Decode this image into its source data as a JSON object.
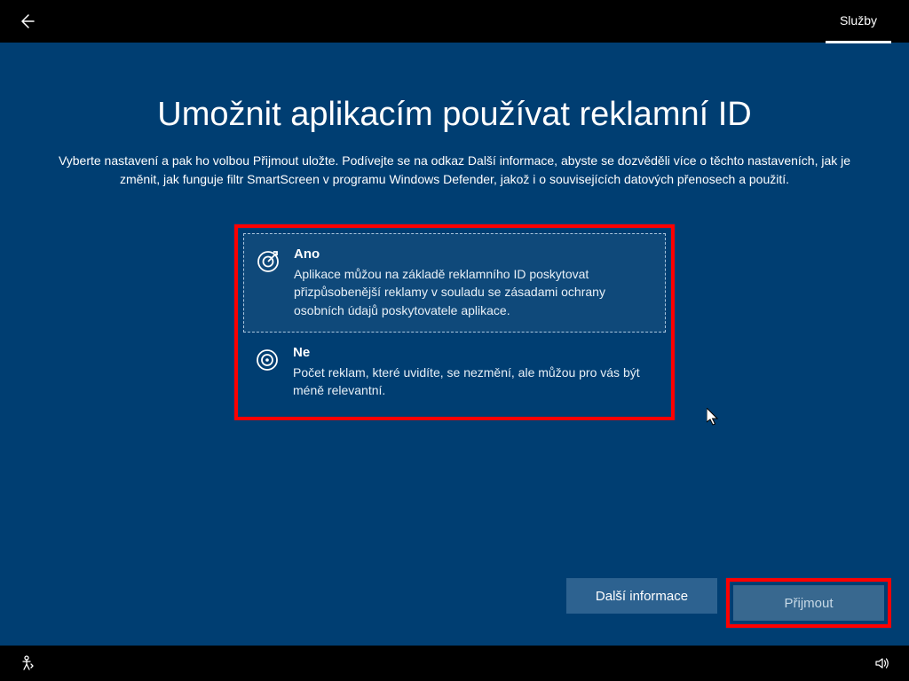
{
  "topbar": {
    "tab_label": "Služby"
  },
  "page": {
    "title": "Umožnit aplikacím používat reklamní ID",
    "subtitle": "Vyberte nastavení a pak ho volbou Přijmout uložte. Podívejte se na odkaz Další informace, abyste se dozvěděli více o těchto nastaveních, jak je změnit, jak funguje filtr SmartScreen v programu Windows Defender, jakož i o souvisejících datových přenosech a použití."
  },
  "options": {
    "yes": {
      "title": "Ano",
      "desc": "Aplikace můžou na základě reklamního ID poskytovat přizpůsobenější reklamy v souladu se zásadami ochrany osobních údajů poskytovatele aplikace."
    },
    "no": {
      "title": "Ne",
      "desc": "Počet reklam, které uvidíte, se nezmění, ale můžou pro vás být méně relevantní."
    }
  },
  "buttons": {
    "more_info": "Další informace",
    "accept": "Přijmout"
  }
}
